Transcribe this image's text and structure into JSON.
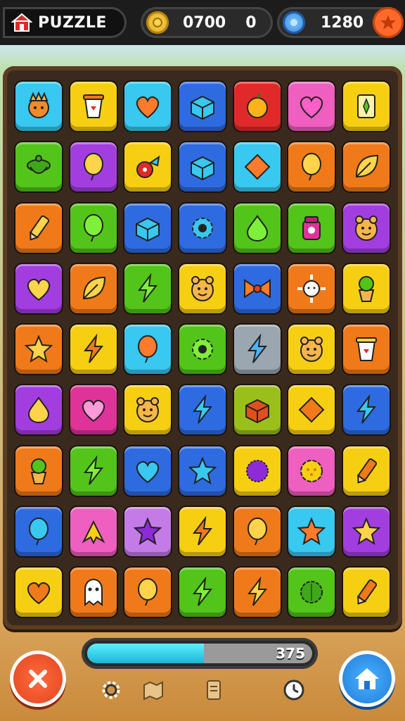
{
  "header": {
    "title": "PUZZLE",
    "coins": "0700",
    "coins_secondary": "0",
    "gems": "1280"
  },
  "progress": {
    "value_label": "375",
    "fill_fraction": 0.52
  },
  "colors": {
    "cyan": "#38c8f0",
    "yellow": "#f7cf12",
    "orange": "#f07a1a",
    "green": "#52c41a",
    "purple": "#a23ee0",
    "blue": "#2f6be0",
    "red": "#e02a2a",
    "pink": "#ef5fbf",
    "gray": "#9aa6b0",
    "olive": "#9bbf1a",
    "lavender": "#c47be8",
    "magenta": "#e0339a"
  },
  "board": {
    "rows": [
      [
        {
          "c": "cyan",
          "i": "creature"
        },
        {
          "c": "yellow",
          "i": "cup"
        },
        {
          "c": "cyan",
          "i": "heart"
        },
        {
          "c": "blue",
          "i": "box"
        },
        {
          "c": "red",
          "i": "fruit"
        },
        {
          "c": "pink",
          "i": "heart"
        },
        {
          "c": "yellow",
          "i": "card"
        }
      ],
      [
        {
          "c": "green",
          "i": "pot"
        },
        {
          "c": "purple",
          "i": "balloon"
        },
        {
          "c": "yellow",
          "i": "candy"
        },
        {
          "c": "blue",
          "i": "box"
        },
        {
          "c": "cyan",
          "i": "diamond"
        },
        {
          "c": "orange",
          "i": "balloon"
        },
        {
          "c": "orange",
          "i": "leaf"
        }
      ],
      [
        {
          "c": "orange",
          "i": "crayon"
        },
        {
          "c": "green",
          "i": "balloon"
        },
        {
          "c": "blue",
          "i": "box"
        },
        {
          "c": "blue",
          "i": "gear"
        },
        {
          "c": "green",
          "i": "drop"
        },
        {
          "c": "green",
          "i": "jar"
        },
        {
          "c": "purple",
          "i": "face"
        }
      ],
      [
        {
          "c": "purple",
          "i": "heart"
        },
        {
          "c": "orange",
          "i": "leaf"
        },
        {
          "c": "green",
          "i": "bolt"
        },
        {
          "c": "yellow",
          "i": "face"
        },
        {
          "c": "blue",
          "i": "bow"
        },
        {
          "c": "orange",
          "i": "sun"
        },
        {
          "c": "yellow",
          "i": "plant"
        }
      ],
      [
        {
          "c": "orange",
          "i": "star"
        },
        {
          "c": "yellow",
          "i": "bolt"
        },
        {
          "c": "cyan",
          "i": "balloon"
        },
        {
          "c": "green",
          "i": "gear"
        },
        {
          "c": "gray",
          "i": "bolt"
        },
        {
          "c": "yellow",
          "i": "face"
        },
        {
          "c": "orange",
          "i": "cup"
        }
      ],
      [
        {
          "c": "purple",
          "i": "drop"
        },
        {
          "c": "magenta",
          "i": "heart"
        },
        {
          "c": "yellow",
          "i": "face"
        },
        {
          "c": "blue",
          "i": "bolt"
        },
        {
          "c": "olive",
          "i": "box"
        },
        {
          "c": "yellow",
          "i": "diamond"
        },
        {
          "c": "blue",
          "i": "bolt"
        }
      ],
      [
        {
          "c": "orange",
          "i": "plant"
        },
        {
          "c": "green",
          "i": "bolt"
        },
        {
          "c": "blue",
          "i": "heart"
        },
        {
          "c": "blue",
          "i": "star"
        },
        {
          "c": "yellow",
          "i": "blob"
        },
        {
          "c": "pink",
          "i": "flower"
        },
        {
          "c": "yellow",
          "i": "crayon"
        }
      ],
      [
        {
          "c": "blue",
          "i": "balloon"
        },
        {
          "c": "pink",
          "i": "arrow"
        },
        {
          "c": "lavender",
          "i": "star"
        },
        {
          "c": "yellow",
          "i": "bolt"
        },
        {
          "c": "orange",
          "i": "balloon"
        },
        {
          "c": "cyan",
          "i": "star"
        },
        {
          "c": "purple",
          "i": "star"
        }
      ],
      [
        {
          "c": "yellow",
          "i": "heart"
        },
        {
          "c": "orange",
          "i": "ghost"
        },
        {
          "c": "orange",
          "i": "balloon"
        },
        {
          "c": "green",
          "i": "bolt"
        },
        {
          "c": "orange",
          "i": "bolt"
        },
        {
          "c": "green",
          "i": "bush"
        },
        {
          "c": "yellow",
          "i": "crayon"
        }
      ]
    ]
  }
}
